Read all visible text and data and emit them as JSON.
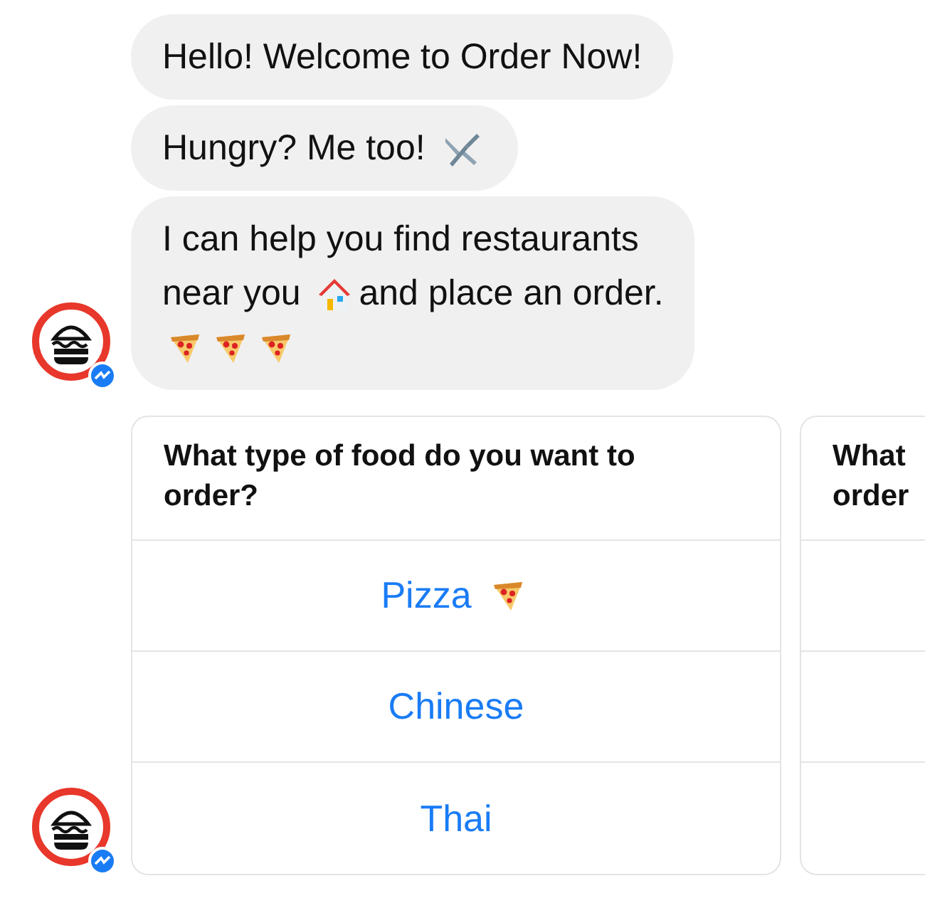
{
  "messages": [
    {
      "parts": [
        {
          "kind": "text",
          "text": "Hello! Welcome to Order Now!"
        }
      ]
    },
    {
      "parts": [
        {
          "kind": "text",
          "text": "Hungry? Me too!"
        },
        {
          "kind": "cutlery"
        }
      ]
    },
    {
      "parts": [
        {
          "kind": "text",
          "text": "I can help you find restaurants"
        },
        {
          "kind": "break"
        },
        {
          "kind": "text",
          "text": "near you"
        },
        {
          "kind": "house"
        },
        {
          "kind": "text",
          "text": "and place an order."
        },
        {
          "kind": "break"
        },
        {
          "kind": "pizza"
        },
        {
          "kind": "pizza"
        },
        {
          "kind": "pizza"
        }
      ]
    }
  ],
  "cards": [
    {
      "title_lines": [
        "What type of food do you want to",
        "order?"
      ],
      "options": [
        {
          "label": "Pizza",
          "kind": "pizza"
        },
        {
          "label": "Chinese",
          "kind": "plain"
        },
        {
          "label": "Thai",
          "kind": "plain"
        }
      ]
    },
    {
      "title_lines": [
        "What",
        "order"
      ]
    }
  ]
}
